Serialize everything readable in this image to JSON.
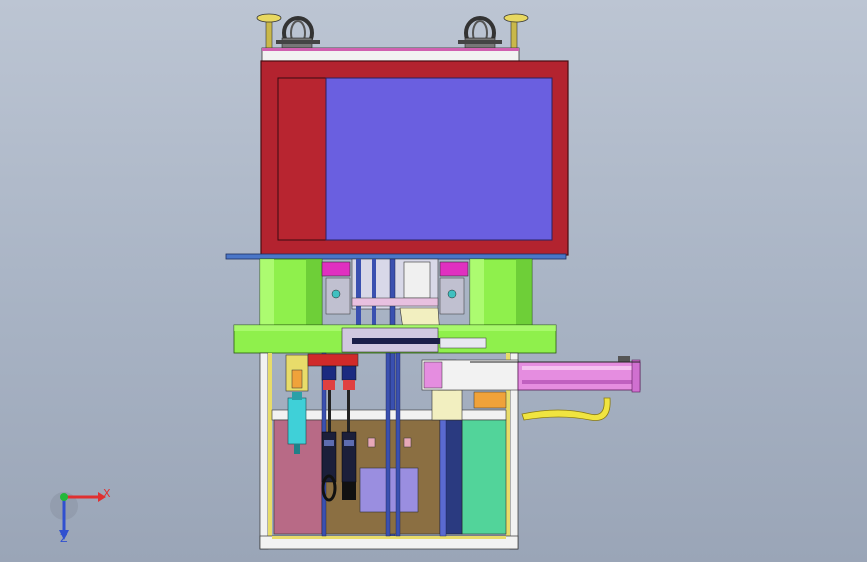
{
  "viewport": {
    "background_top": "#bcc5d3",
    "background_bottom": "#9aa5b7"
  },
  "model": {
    "colors": {
      "housing_red": "#b3232f",
      "panel_blue": "#6a5fe0",
      "cylinder_green": "#8ff04c",
      "frame_white": "#f2f2f2",
      "frame_yellow": "#e8dc6a",
      "plate_brown": "#8b6f42",
      "plate_pink": "#b86a86",
      "plate_teal": "#52d49a",
      "slide_pink": "#e58de0",
      "accent_orange": "#f0a23a",
      "actuator_cyan": "#3fd0d8",
      "magenta": "#e030c0",
      "dark_navy": "#1b1f4a"
    }
  },
  "triad": {
    "x_label": "X",
    "z_label": "Z",
    "x_color": "#e03030",
    "y_color": "#22b83a",
    "z_color": "#3050d0"
  }
}
